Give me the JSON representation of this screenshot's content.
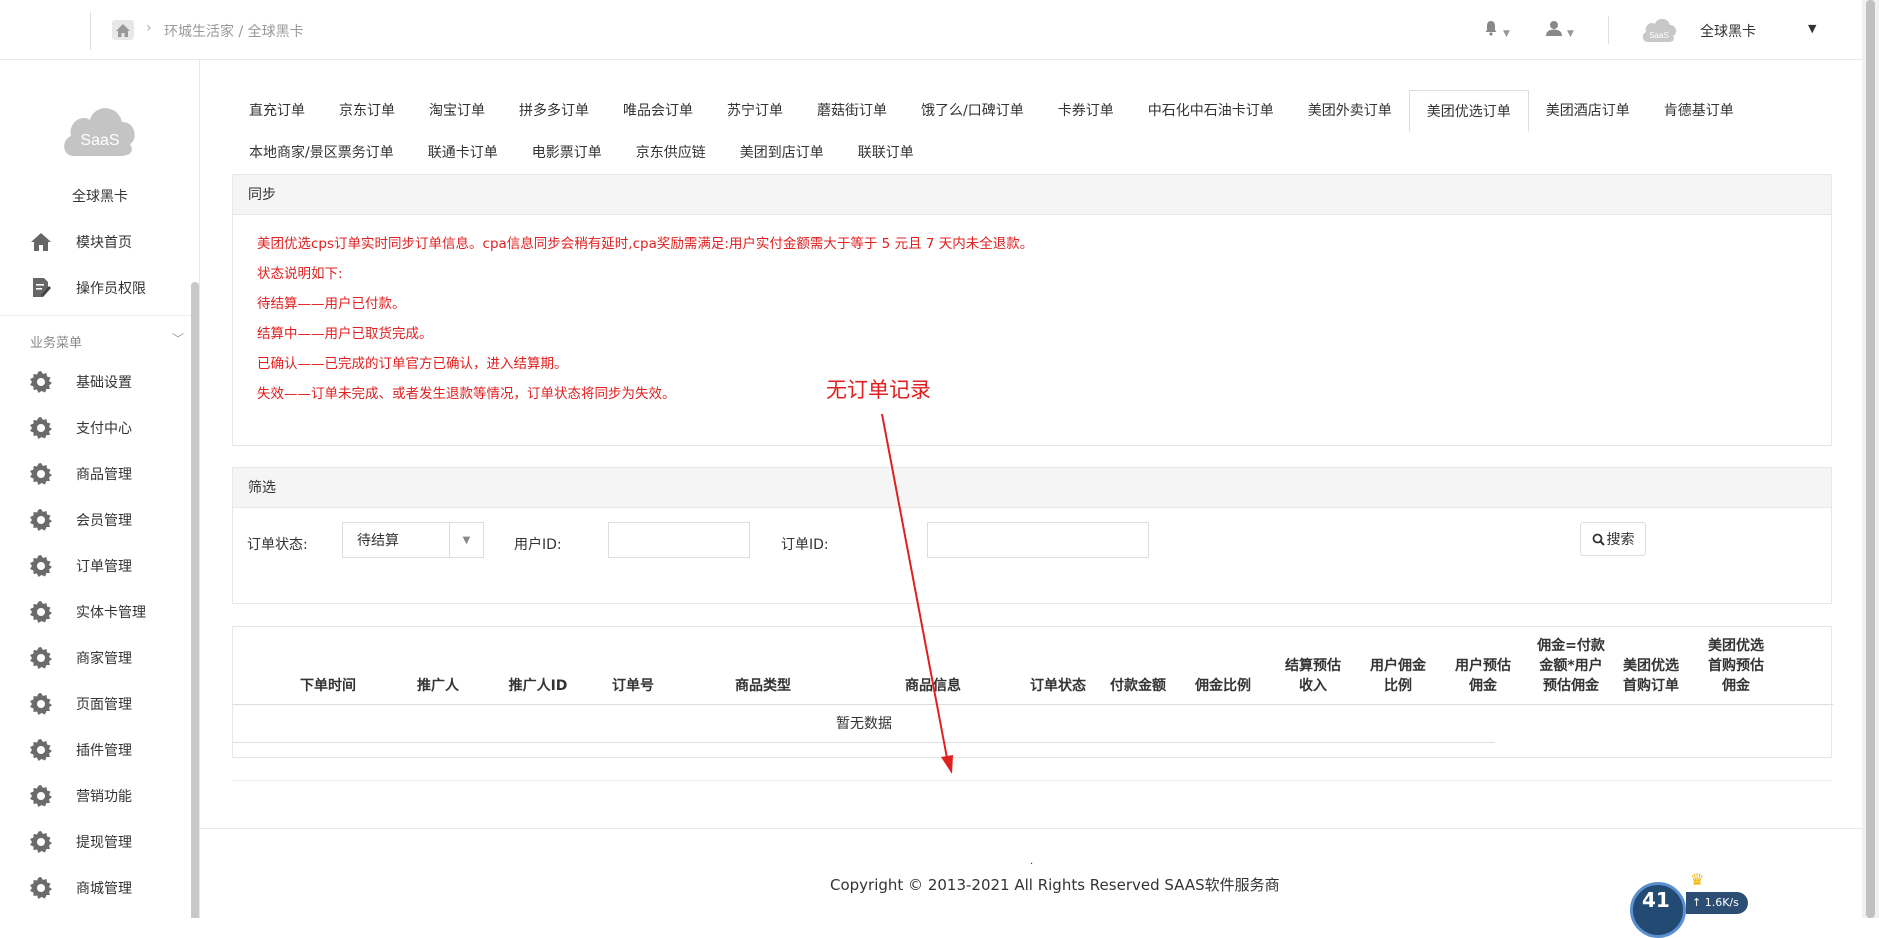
{
  "topbar": {
    "breadcrumb": "环城生活家 / 全球黑卡",
    "user_name": "全球黑卡",
    "cloud_label": "SaaS"
  },
  "sidebar": {
    "logo_label": "SaaS",
    "name": "全球黑卡",
    "top_items": [
      {
        "label": "模块首页",
        "icon": "home-icon"
      },
      {
        "label": "操作员权限",
        "icon": "edit-icon"
      }
    ],
    "section_label": "业务菜单",
    "items": [
      {
        "label": "基础设置",
        "icon": "gear-icon"
      },
      {
        "label": "支付中心",
        "icon": "gear-icon"
      },
      {
        "label": "商品管理",
        "icon": "gear-icon"
      },
      {
        "label": "会员管理",
        "icon": "gear-icon"
      },
      {
        "label": "订单管理",
        "icon": "gear-icon"
      },
      {
        "label": "实体卡管理",
        "icon": "gear-icon"
      },
      {
        "label": "商家管理",
        "icon": "gear-icon"
      },
      {
        "label": "页面管理",
        "icon": "gear-icon"
      },
      {
        "label": "插件管理",
        "icon": "gear-icon"
      },
      {
        "label": "营销功能",
        "icon": "gear-icon"
      },
      {
        "label": "提现管理",
        "icon": "gear-icon"
      },
      {
        "label": "商城管理",
        "icon": "gear-icon"
      }
    ]
  },
  "tabs": {
    "row1": [
      "直充订单",
      "京东订单",
      "淘宝订单",
      "拼多多订单",
      "唯品会订单",
      "苏宁订单",
      "蘑菇街订单",
      "饿了么/口碑订单",
      "卡券订单",
      "中石化中石油卡订单",
      "美团外卖订单",
      "美团优选订单",
      "美团酒店订单",
      "肯德基订单"
    ],
    "row2": [
      "本地商家/景区票务订单",
      "联通卡订单",
      "电影票订单",
      "京东供应链",
      "美团到店订单",
      "联联订单"
    ],
    "active": "美团优选订单"
  },
  "sync": {
    "title": "同步",
    "lines": [
      "美团优选cps订单实时同步订单信息。cpa信息同步会稍有延时,cpa奖励需满足:用户实付金额需大于等于 5 元且 7 天内未全退款。",
      "状态说明如下:",
      "待结算——用户已付款。",
      "结算中——用户已取货完成。",
      "已确认——已完成的订单官方已确认，进入结算期。",
      "失效——订单未完成、或者发生退款等情况，订单状态将同步为失效。"
    ]
  },
  "filter": {
    "title": "筛选",
    "status_label": "订单状态:",
    "status_value": "待结算",
    "user_id_label": "用户ID:",
    "order_id_label": "订单ID:",
    "search_label": "搜索"
  },
  "table": {
    "columns": [
      "下单时间",
      "推广人",
      "推广人ID",
      "订单号",
      "商品类型",
      "商品信息",
      "订单状态",
      "付款金额",
      "佣金比例",
      "结算预估\n收入",
      "用户佣金\n比例",
      "用户预估\n佣金",
      "佣金=付款\n金额*用户\n预估佣金",
      "美团优选\n首购订单",
      "美团优选\n首购预估\n佣金"
    ],
    "empty_text": "暂无数据"
  },
  "annotation": {
    "text": "无订单记录",
    "color": "#e02020"
  },
  "footer": {
    "dot": ".",
    "copyright": "Copyright © 2013-2021 All Rights Reserved SAAS软件服务商"
  },
  "net_widget": {
    "percent": "41",
    "speed": "1.6K/s"
  }
}
